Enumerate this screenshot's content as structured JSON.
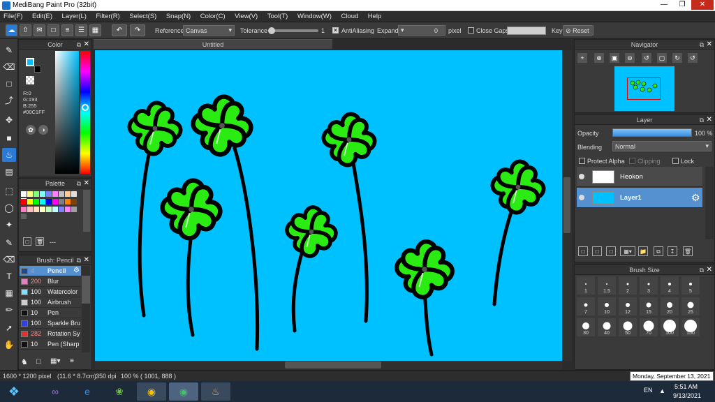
{
  "app": {
    "title": "MediBang Paint Pro (32bit)"
  },
  "menu": [
    "File(F)",
    "Edit(E)",
    "Layer(L)",
    "Filter(R)",
    "Select(S)",
    "Snap(N)",
    "Color(C)",
    "View(V)",
    "Tool(T)",
    "Window(W)",
    "Cloud",
    "Help"
  ],
  "toolbar": {
    "reference_label": "Reference",
    "reference_value": "Canvas",
    "tolerance_label": "Tolerance",
    "tolerance_value": "1",
    "antialiasing_label": "AntiAliasing",
    "expand_label": "Expand",
    "expand_value": "0",
    "expand_unit": "pixel",
    "close_gaps_label": "Close Gaps",
    "key_label": "Key",
    "reset_label": "Reset"
  },
  "color_panel": {
    "title": "Color",
    "r": "R:0",
    "g": "G:193",
    "b": "B:255",
    "hex": "#00C1FF",
    "current_color": "#00C1FF"
  },
  "palette_panel": {
    "title": "Palette",
    "footer_text": "---",
    "rows": [
      [
        "#ffffff",
        "#ffff80",
        "#80ff80",
        "#80ffff",
        "#8080ff",
        "#ff80ff",
        "#c0c0c0",
        "#ffcc99",
        "#e0e0e0",
        "#ffffff"
      ],
      [
        "#ff0000",
        "#ffff00",
        "#00ff00",
        "#00ffff",
        "#0000ff",
        "#ff00ff",
        "#808080",
        "#ff8000",
        "#804000",
        "#000000"
      ],
      [
        "#ff80c0",
        "#ffc0c0",
        "#ffe0c0",
        "#ffffc0",
        "#c0ffc0",
        "#c0ffff",
        "#8080ff",
        "#ff80ff",
        "#a0a0a0",
        "#606060"
      ]
    ]
  },
  "brush_panel": {
    "title": "Brush: Pencil",
    "items": [
      {
        "size": "4",
        "name": "Pencil",
        "color": "#1a4d8c"
      },
      {
        "size": "200",
        "name": "Blur",
        "color": "#e080c0"
      },
      {
        "size": "100",
        "name": "Watercolor",
        "color": "#80e0ff"
      },
      {
        "size": "100",
        "name": "Airbrush",
        "color": "#cfcfcf"
      },
      {
        "size": "10",
        "name": "Pen",
        "color": "#111111"
      },
      {
        "size": "100",
        "name": "Sparkle Bru",
        "color": "#3040e0"
      },
      {
        "size": "282",
        "name": "Rotation Sy",
        "color": "#e03030"
      },
      {
        "size": "10",
        "name": "Pen (Sharp",
        "color": "#111111"
      }
    ]
  },
  "document": {
    "tab": "Untitled"
  },
  "navigator": {
    "title": "Navigator"
  },
  "layer_panel": {
    "title": "Layer",
    "opacity_label": "Opacity",
    "opacity_value": "100 %",
    "opacity_fraction": 1.0,
    "blending_label": "Blending",
    "blending_value": "Normal",
    "protect_alpha_label": "Protect Alpha",
    "clipping_label": "Clipping",
    "lock_label": "Lock",
    "layers": [
      {
        "name": "Heokon",
        "selected": false
      },
      {
        "name": "Layer1",
        "selected": true
      }
    ]
  },
  "brush_size_panel": {
    "title": "Brush Size",
    "sizes": [
      "1",
      "1.5",
      "2",
      "3",
      "4",
      "5",
      "7",
      "10",
      "12",
      "15",
      "20",
      "25",
      "30",
      "40",
      "50",
      "70",
      "100",
      "150"
    ]
  },
  "status": {
    "image_size": "1600 * 1200 pixel",
    "physical_size": "(11.6 * 8.7cm)",
    "dpi": "350 dpi",
    "zoom": "100 %",
    "coords": "( 1001, 888 )",
    "tooltip_date": "Monday, September 13, 2021"
  },
  "taskbar": {
    "language": "EN",
    "time": "5:51 AM",
    "date": "9/13/2021"
  }
}
